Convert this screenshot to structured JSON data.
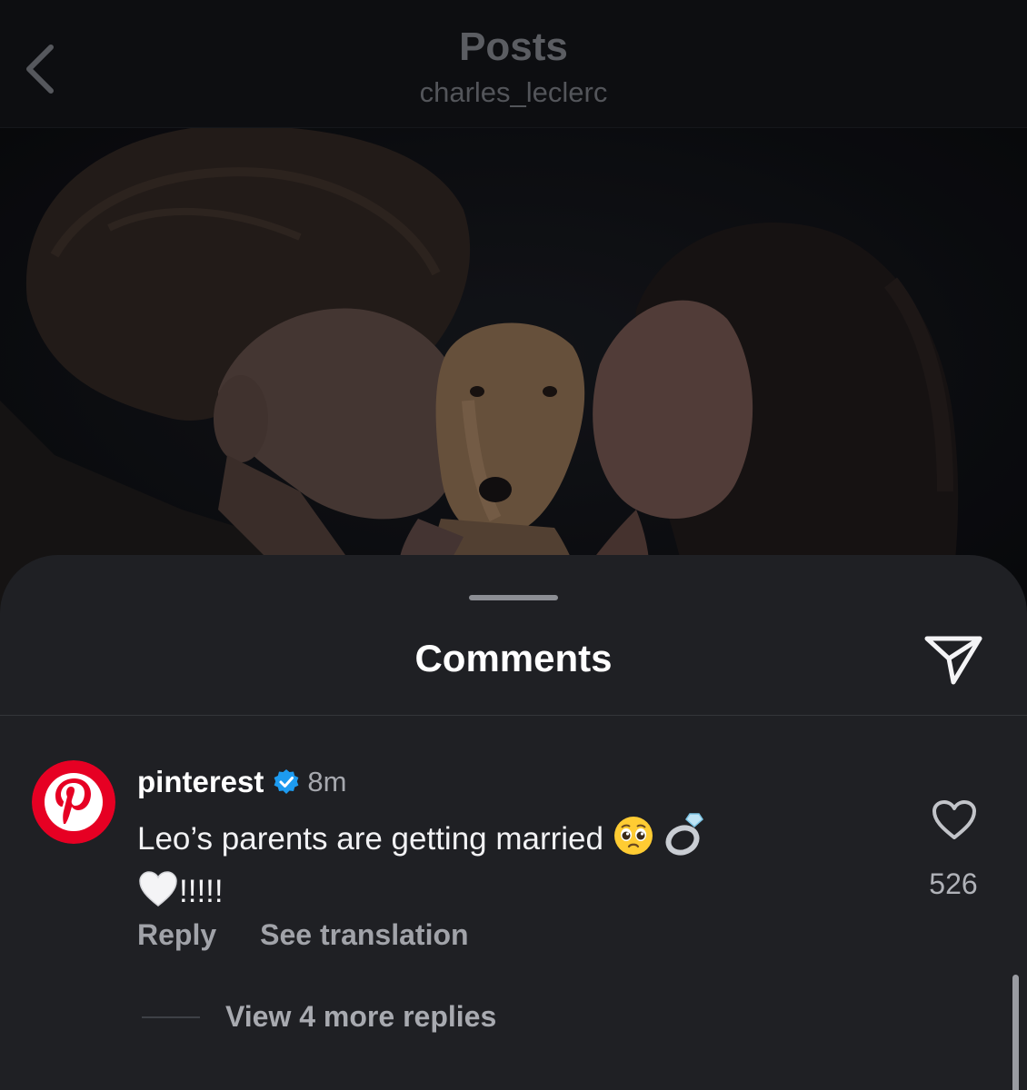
{
  "header": {
    "title": "Posts",
    "subtitle": "charles_leclerc",
    "back_icon": "chevron-left-icon"
  },
  "post": {
    "photo_subject": "couple-kissing-dog-photo"
  },
  "comments_sheet": {
    "title": "Comments",
    "share_icon": "paper-plane-icon"
  },
  "comment": {
    "username": "pinterest",
    "verified": true,
    "timestamp": "8m",
    "text": "Leo’s parents are getting married",
    "text_suffix": "!!!!!",
    "emojis": [
      "pleading-face-icon",
      "ring-icon",
      "white-heart-icon"
    ],
    "like_count": "526",
    "reply_label": "Reply",
    "translate_label": "See translation",
    "view_replies_label": "View 4 more replies"
  },
  "colors": {
    "background": "#0b0c0f",
    "sheet": "#1f2024",
    "text_primary": "#ffffff",
    "text_secondary": "#a1a3a9",
    "pinterest_red": "#e60023",
    "verified_blue": "#1d9bf0"
  }
}
